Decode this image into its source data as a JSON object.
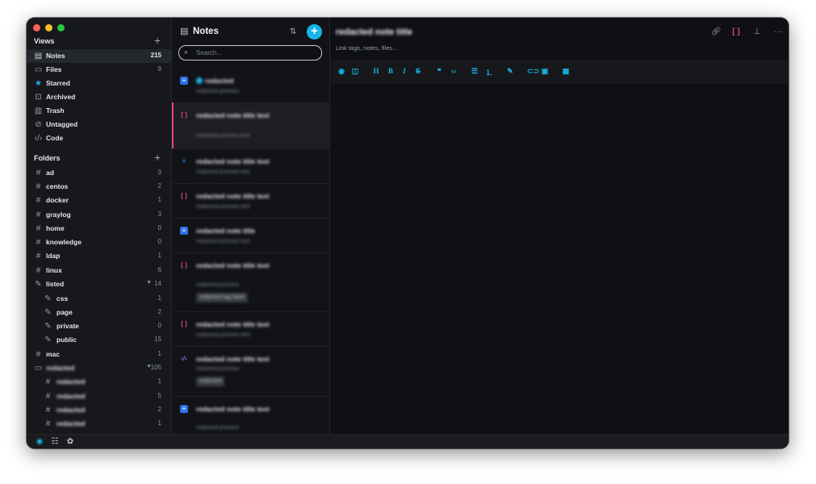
{
  "sidebar": {
    "views_label": "Views",
    "views": [
      {
        "label": "Notes",
        "count": "215",
        "icon": "notes-icon"
      },
      {
        "label": "Files",
        "count": "9",
        "icon": "folder-icon"
      },
      {
        "label": "Starred",
        "count": "",
        "icon": "star-icon"
      },
      {
        "label": "Archived",
        "count": "",
        "icon": "archive-icon"
      },
      {
        "label": "Trash",
        "count": "",
        "icon": "trash-icon"
      },
      {
        "label": "Untagged",
        "count": "",
        "icon": "untagged-icon"
      },
      {
        "label": "Code",
        "count": "",
        "icon": "code-icon"
      }
    ],
    "folders_label": "Folders",
    "folders": [
      {
        "label": "ad",
        "count": "3"
      },
      {
        "label": "centos",
        "count": "2"
      },
      {
        "label": "docker",
        "count": "1"
      },
      {
        "label": "graylog",
        "count": "3"
      },
      {
        "label": "home",
        "count": "0"
      },
      {
        "label": "knowledge",
        "count": "0"
      },
      {
        "label": "ldap",
        "count": "1"
      },
      {
        "label": "linux",
        "count": "6"
      },
      {
        "label": "listed",
        "count": "14"
      },
      {
        "label": "css",
        "count": "1"
      },
      {
        "label": "page",
        "count": "2"
      },
      {
        "label": "private",
        "count": "0"
      },
      {
        "label": "public",
        "count": "15"
      },
      {
        "label": "mac",
        "count": "1"
      },
      {
        "label": "redacted",
        "count": "105"
      },
      {
        "label": "redacted",
        "count": "1"
      },
      {
        "label": "redacted",
        "count": "5"
      },
      {
        "label": "redacted",
        "count": "2"
      },
      {
        "label": "redacted",
        "count": "1"
      }
    ],
    "colors": {
      "accent": "#16b4e6",
      "selected_bar": "#e4467a"
    }
  },
  "notes": {
    "title": "Notes",
    "search_placeholder": "Search...",
    "items": [
      {
        "title": "redacted",
        "subtitle": "redacted preview",
        "type": "doc"
      },
      {
        "title": "redacted note title text",
        "subtitle": "redacted preview text",
        "type": "bracket"
      },
      {
        "title": "redacted note title text",
        "subtitle": "redacted preview text",
        "type": "text"
      },
      {
        "title": "redacted note title text",
        "subtitle": "redacted preview text",
        "type": "bracket"
      },
      {
        "title": "redacted note title",
        "subtitle": "redacted preview text",
        "type": "doc"
      },
      {
        "title": "redacted note title text",
        "subtitle": "redacted preview",
        "tag": "redacted tag label",
        "type": "bracket"
      },
      {
        "title": "redacted note title text",
        "subtitle": "redacted preview text",
        "type": "bracket"
      },
      {
        "title": "redacted note title text",
        "subtitle": "redacted preview",
        "tag": "redacted",
        "type": "code"
      },
      {
        "title": "redacted note title text",
        "subtitle": "redacted preview",
        "type": "doc"
      }
    ]
  },
  "editor": {
    "title": "redacted note title",
    "links_placeholder": "Link tags, notes, files..."
  }
}
